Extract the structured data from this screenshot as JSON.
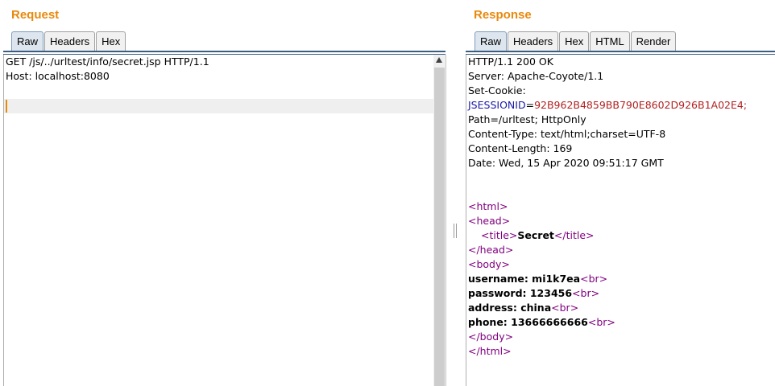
{
  "request": {
    "title": "Request",
    "tabs": [
      "Raw",
      "Headers",
      "Hex"
    ],
    "active_tab": "Raw",
    "lines": [
      "GET /js/../urltest/info/secret.jsp HTTP/1.1",
      "Host: localhost:8080"
    ]
  },
  "response": {
    "title": "Response",
    "tabs": [
      "Raw",
      "Headers",
      "Hex",
      "HTML",
      "Render"
    ],
    "active_tab": "Raw",
    "status_line": "HTTP/1.1 200 OK",
    "server": "Server: Apache-Coyote/1.1",
    "set_cookie": "Set-Cookie:",
    "cookie_name": "JSESSIONID",
    "cookie_eq": "=",
    "cookie_value": "92B962B4859BB790E8602D926B1A02E4;",
    "cookie_path": "Path=/urltest; HttpOnly",
    "content_type": "Content-Type: text/html;charset=UTF-8",
    "content_length": "Content-Length: 169",
    "date": "Date: Wed, 15 Apr 2020 09:51:17 GMT",
    "html": {
      "open_html": "<html>",
      "open_head": "<head>",
      "open_title": "<title>",
      "title_text": "Secret",
      "close_title": "</title>",
      "close_head": "</head>",
      "open_body": "<body>",
      "rows": [
        {
          "text": "username: mi1k7ea",
          "tag": "<br>"
        },
        {
          "text": "password: 123456",
          "tag": "<br>"
        },
        {
          "text": "address: china",
          "tag": "<br>"
        },
        {
          "text": "phone: 13666666666",
          "tag": "<br>"
        }
      ],
      "close_body": "</body>",
      "close_html": "</html>"
    }
  },
  "colors": {
    "title": "#e8890c",
    "tag": "#800080",
    "header_name": "#1a1aa6",
    "header_value": "#b22222",
    "active_tab": "#dde5ee"
  }
}
